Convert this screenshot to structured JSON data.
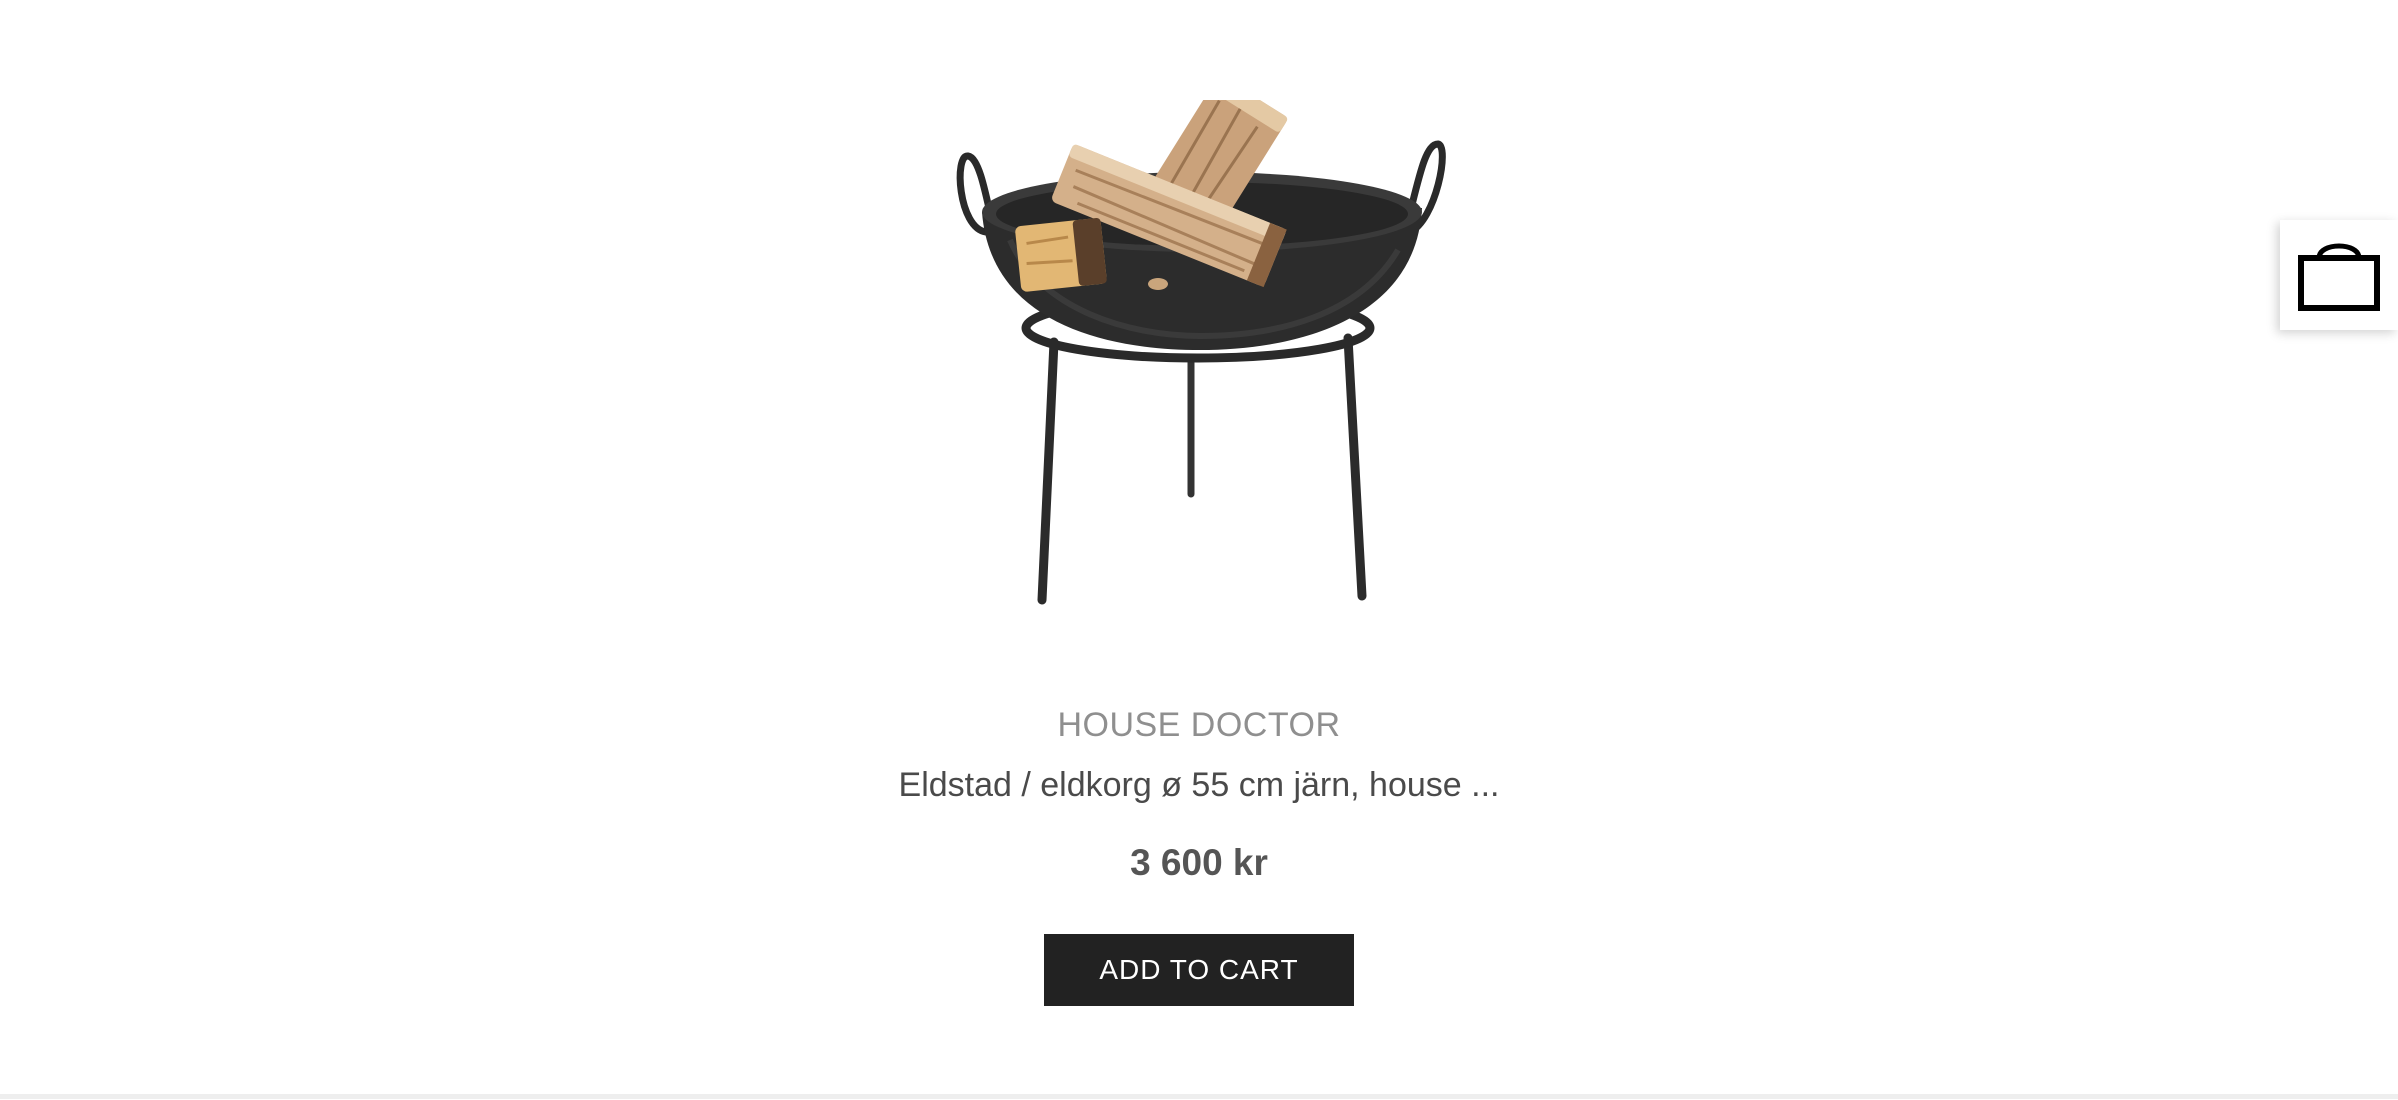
{
  "product": {
    "brand": "HOUSE DOCTOR",
    "title": "Eldstad / eldkorg ø 55 cm järn, house ...",
    "price": "3 600 kr",
    "add_to_cart_label": "ADD TO CART",
    "image_subject": "fire-pit-with-logs"
  },
  "cart": {
    "icon": "shopping-bag-icon"
  },
  "colors": {
    "button_bg": "#222222",
    "button_text": "#ffffff",
    "brand_text": "#8f8f8f",
    "title_text": "#4a4a4a",
    "price_text": "#555555"
  }
}
